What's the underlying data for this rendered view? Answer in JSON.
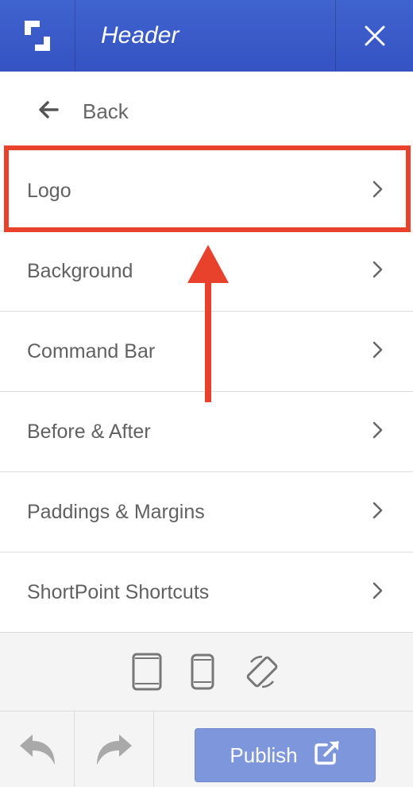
{
  "header": {
    "title": "Header",
    "logo_icon": "shortpoint-logo-icon",
    "close_icon": "close-icon",
    "bg_color": "#3a5bcb"
  },
  "back": {
    "label": "Back",
    "icon": "arrow-left-icon"
  },
  "menu": {
    "items": [
      {
        "label": "Logo"
      },
      {
        "label": "Background"
      },
      {
        "label": "Command Bar"
      },
      {
        "label": "Before & After"
      },
      {
        "label": "Paddings & Margins"
      },
      {
        "label": "ShortPoint Shortcuts"
      }
    ],
    "chevron_icon": "chevron-right-icon"
  },
  "annotation": {
    "highlight_color": "#e8412c"
  },
  "devices": [
    "tablet-icon",
    "phone-icon",
    "rotate-device-icon"
  ],
  "footer": {
    "undo_icon": "undo-icon",
    "redo_icon": "redo-icon",
    "publish_label": "Publish",
    "publish_icon": "external-link-icon",
    "publish_color": "#7e97dc"
  }
}
